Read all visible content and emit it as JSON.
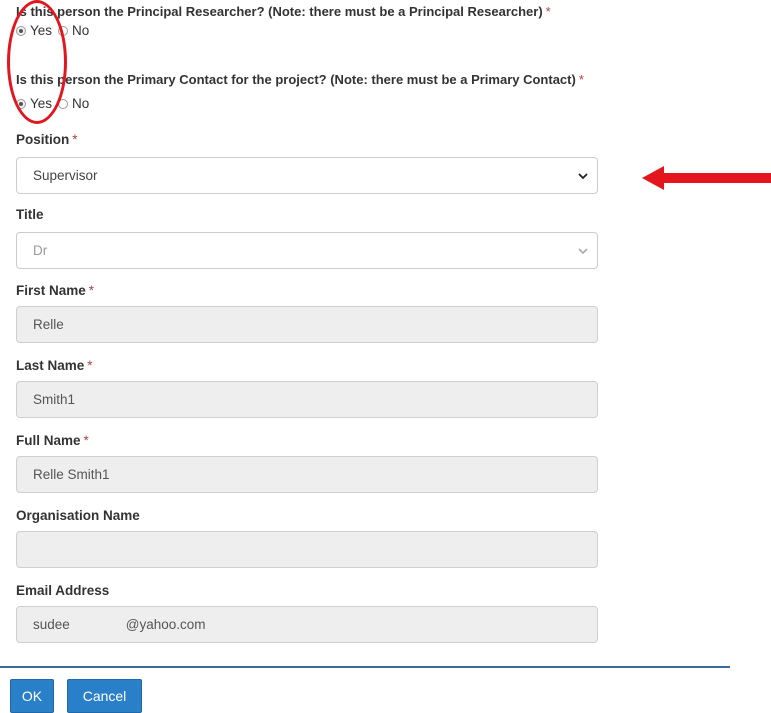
{
  "questions": [
    {
      "label": "Is this person the Principal Researcher? (Note: there must be a Principal Researcher)",
      "required": "*",
      "options": [
        {
          "label": "Yes",
          "checked": true
        },
        {
          "label": "No",
          "checked": false
        }
      ]
    },
    {
      "label": "Is this person the Primary Contact for the project? (Note: there must be a Primary Contact)",
      "required": "*",
      "options": [
        {
          "label": "Yes",
          "checked": true
        },
        {
          "label": "No",
          "checked": false
        }
      ]
    }
  ],
  "position": {
    "label": "Position",
    "required": "*",
    "value": "Supervisor"
  },
  "title_field": {
    "label": "Title",
    "value": "Dr"
  },
  "first_name": {
    "label": "First Name",
    "required": "*",
    "value": "Relle"
  },
  "last_name": {
    "label": "Last Name",
    "required": "*",
    "value": "Smith1"
  },
  "full_name": {
    "label": "Full Name",
    "required": "*",
    "value": "Relle Smith1"
  },
  "organisation": {
    "label": "Organisation Name",
    "value": ""
  },
  "email": {
    "label": "Email Address",
    "value_left": "sudee",
    "value_right": "@yahoo.com"
  },
  "buttons": {
    "ok": "OK",
    "cancel": "Cancel"
  },
  "annotations": {
    "circle_color": "#e3161e",
    "arrow_color": "#e3161e"
  },
  "colors": {
    "accent": "#2a7fc9",
    "required": "#a94442",
    "divider": "#3a6a98"
  }
}
